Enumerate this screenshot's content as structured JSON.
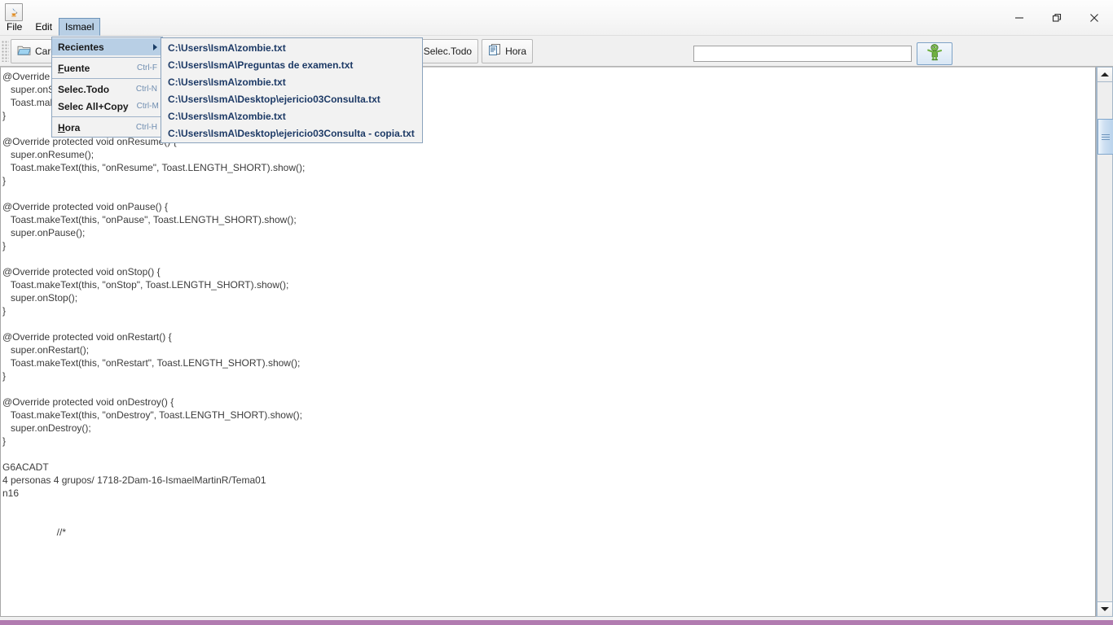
{
  "window": {
    "app_icon": "java-coffee-cup-icon",
    "minimize_label": "—",
    "maximize_label": "❐",
    "close_label": "✕"
  },
  "menubar": {
    "items": [
      {
        "label": "File",
        "active": false
      },
      {
        "label": "Edit",
        "active": false
      },
      {
        "label": "Ismael",
        "active": true
      }
    ]
  },
  "menu": {
    "items": [
      {
        "label": "Recientes",
        "accel": "",
        "submenu": true,
        "highlight": true,
        "mnemonic": ""
      },
      {
        "sep": true
      },
      {
        "label": "Fuente",
        "accel": "Ctrl-F",
        "submenu": false,
        "highlight": false,
        "mnemonic": "F"
      },
      {
        "sep": true
      },
      {
        "label": "Selec.Todo",
        "accel": "Ctrl-N",
        "submenu": false,
        "highlight": false,
        "mnemonic": ""
      },
      {
        "label": "Selec All+Copy",
        "accel": "Ctrl-M",
        "submenu": false,
        "highlight": false,
        "mnemonic": ""
      },
      {
        "sep": true
      },
      {
        "label": "Hora",
        "accel": "Ctrl-H",
        "submenu": false,
        "highlight": false,
        "mnemonic": "H"
      }
    ]
  },
  "submenu": {
    "items": [
      "C:\\Users\\IsmA\\zombie.txt",
      "C:\\Users\\IsmA\\Preguntas de examen.txt",
      "C:\\Users\\IsmA\\zombie.txt",
      "C:\\Users\\IsmA\\Desktop\\ejericio03Consulta.txt",
      "C:\\Users\\IsmA\\zombie.txt",
      "C:\\Users\\IsmA\\Desktop\\ejericio03Consulta - copia.txt"
    ]
  },
  "toolbar": {
    "load_button": "Cargar",
    "load_icon": "open-folder-icon",
    "select_all_button": "Selec.Todo",
    "select_all_icon": "document-select-icon",
    "time_button": "Hora",
    "time_icon": "document-clock-icon"
  },
  "search": {
    "value": "",
    "placeholder": "",
    "button_icon": "zombie-icon"
  },
  "editor": {
    "content": "@Override protected void onStart() {\n   super.onStart();\n   Toast.makeText(this, \"onStart\", Toast.LENGTH_SHORT).show();\n}\n\n@Override protected void onResume() {\n   super.onResume();\n   Toast.makeText(this, \"onResume\", Toast.LENGTH_SHORT).show();\n}\n\n@Override protected void onPause() {\n   Toast.makeText(this, \"onPause\", Toast.LENGTH_SHORT).show();\n   super.onPause();\n}\n\n@Override protected void onStop() {\n   Toast.makeText(this, \"onStop\", Toast.LENGTH_SHORT).show();\n   super.onStop();\n}\n\n@Override protected void onRestart() {\n   super.onRestart();\n   Toast.makeText(this, \"onRestart\", Toast.LENGTH_SHORT).show();\n}\n\n@Override protected void onDestroy() {\n   Toast.makeText(this, \"onDestroy\", Toast.LENGTH_SHORT).show();\n   super.onDestroy();\n}\n\nG6ACADT\n4 personas 4 grupos/ 1718-2Dam-16-IsmaelMartinR/Tema01\nn16\n\n\n                    //*"
  },
  "scrollbar": {
    "up_arrow": "scroll-up-arrow",
    "down_arrow": "scroll-down-arrow"
  },
  "colors": {
    "menu_highlight": "#b8cfe5",
    "menu_border": "#8ba3bd",
    "submenu_text": "#1d3a66",
    "accel_text": "#6f8db0",
    "bottom_accent": "#b17bb0",
    "toolbar_bg": "#f0f0f0"
  }
}
